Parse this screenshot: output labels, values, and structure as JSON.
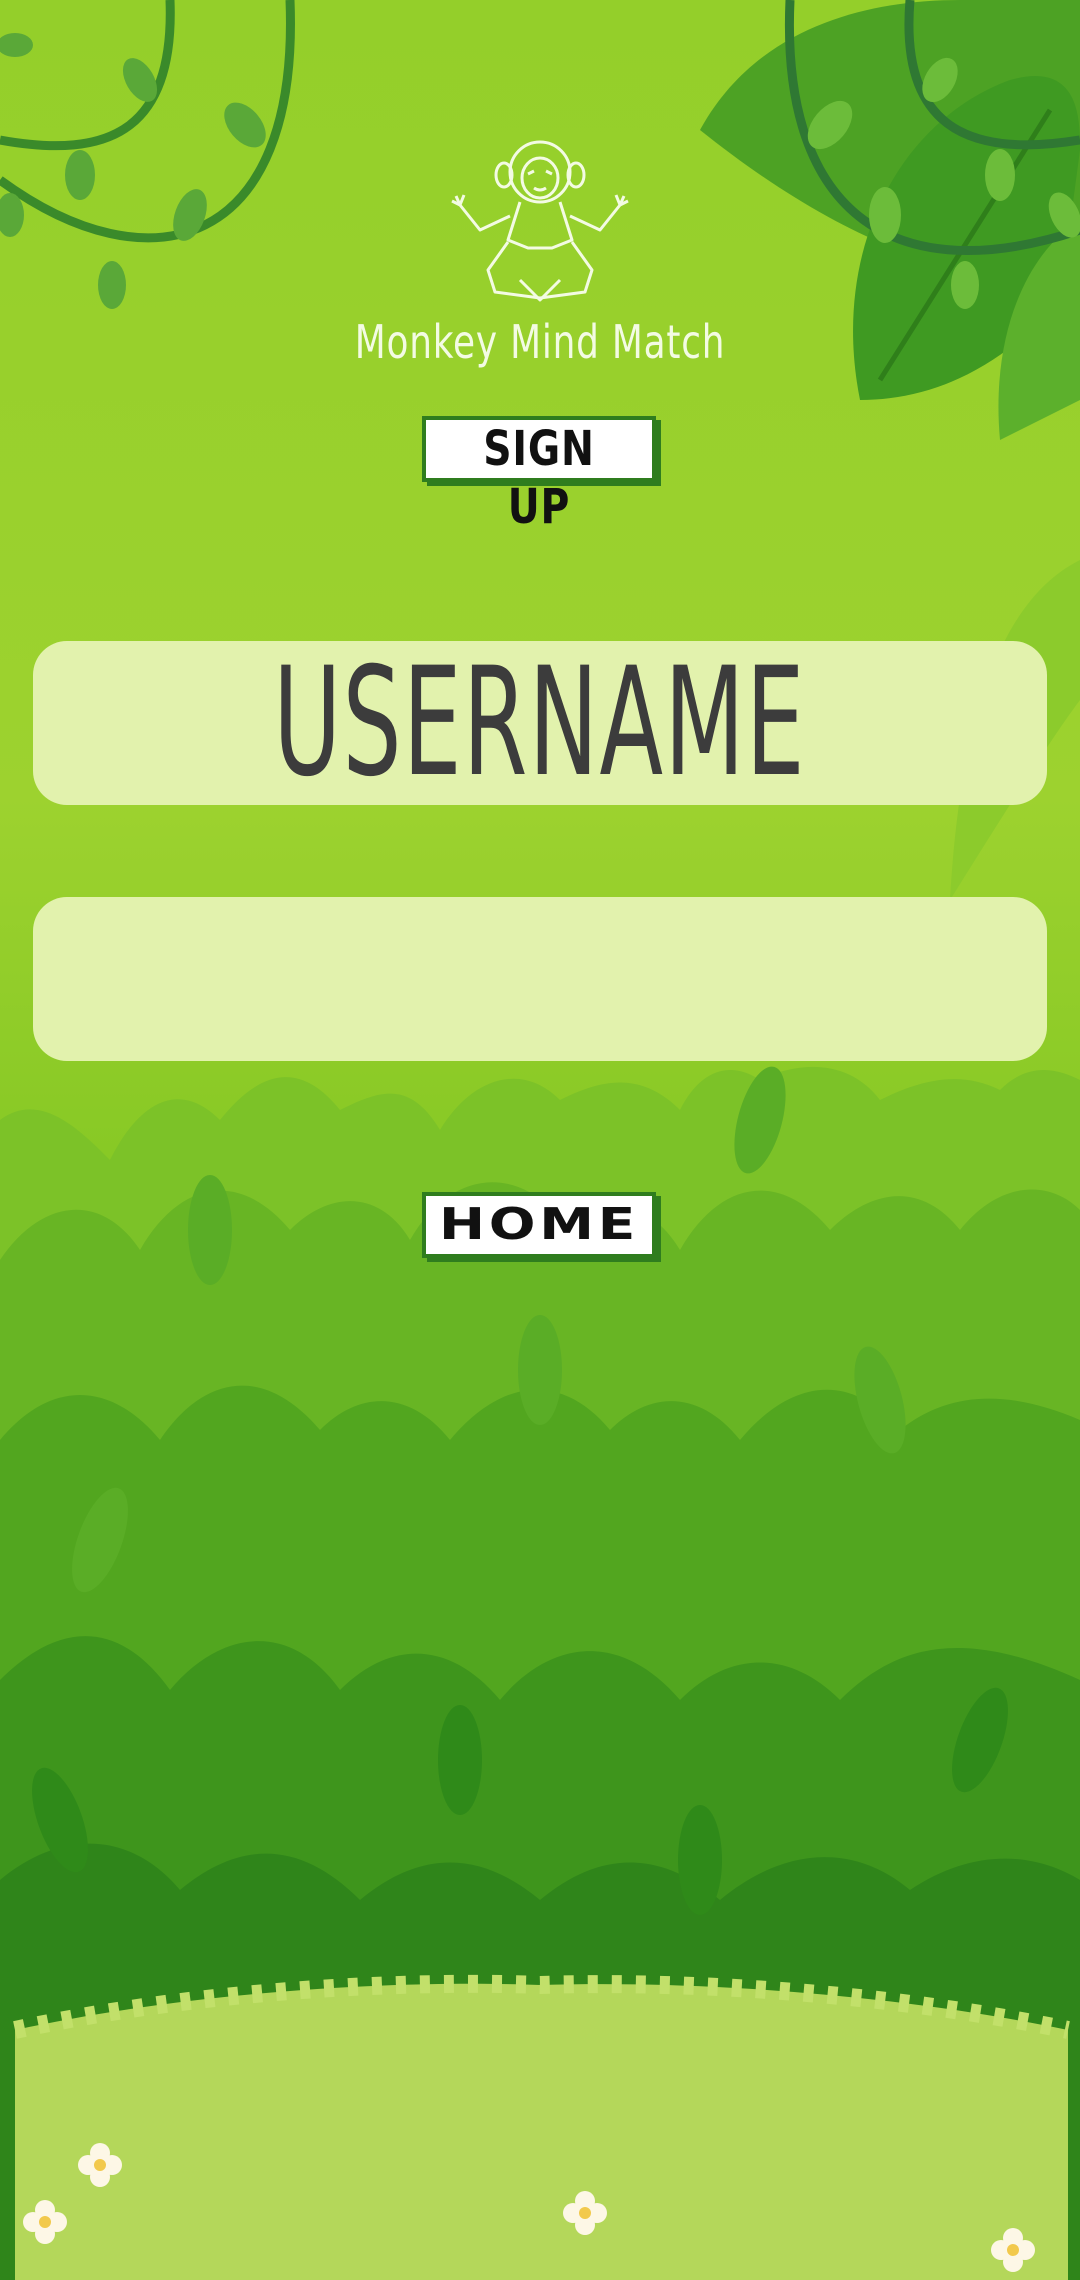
{
  "app": {
    "title": "Monkey Mind Match",
    "logo_icon": "meditating-monkey-icon"
  },
  "signup_button": {
    "label": "SIGN UP"
  },
  "form": {
    "username_placeholder": "USERNAME",
    "second_field_value": ""
  },
  "home_button": {
    "label": "HOME"
  },
  "colors": {
    "jungle_light": "#9dd22f",
    "jungle_dark": "#2e8a1b",
    "field_bg": "#e2f2ad",
    "button_border": "#2f7d1e",
    "text_dark": "#3c3c3c"
  }
}
